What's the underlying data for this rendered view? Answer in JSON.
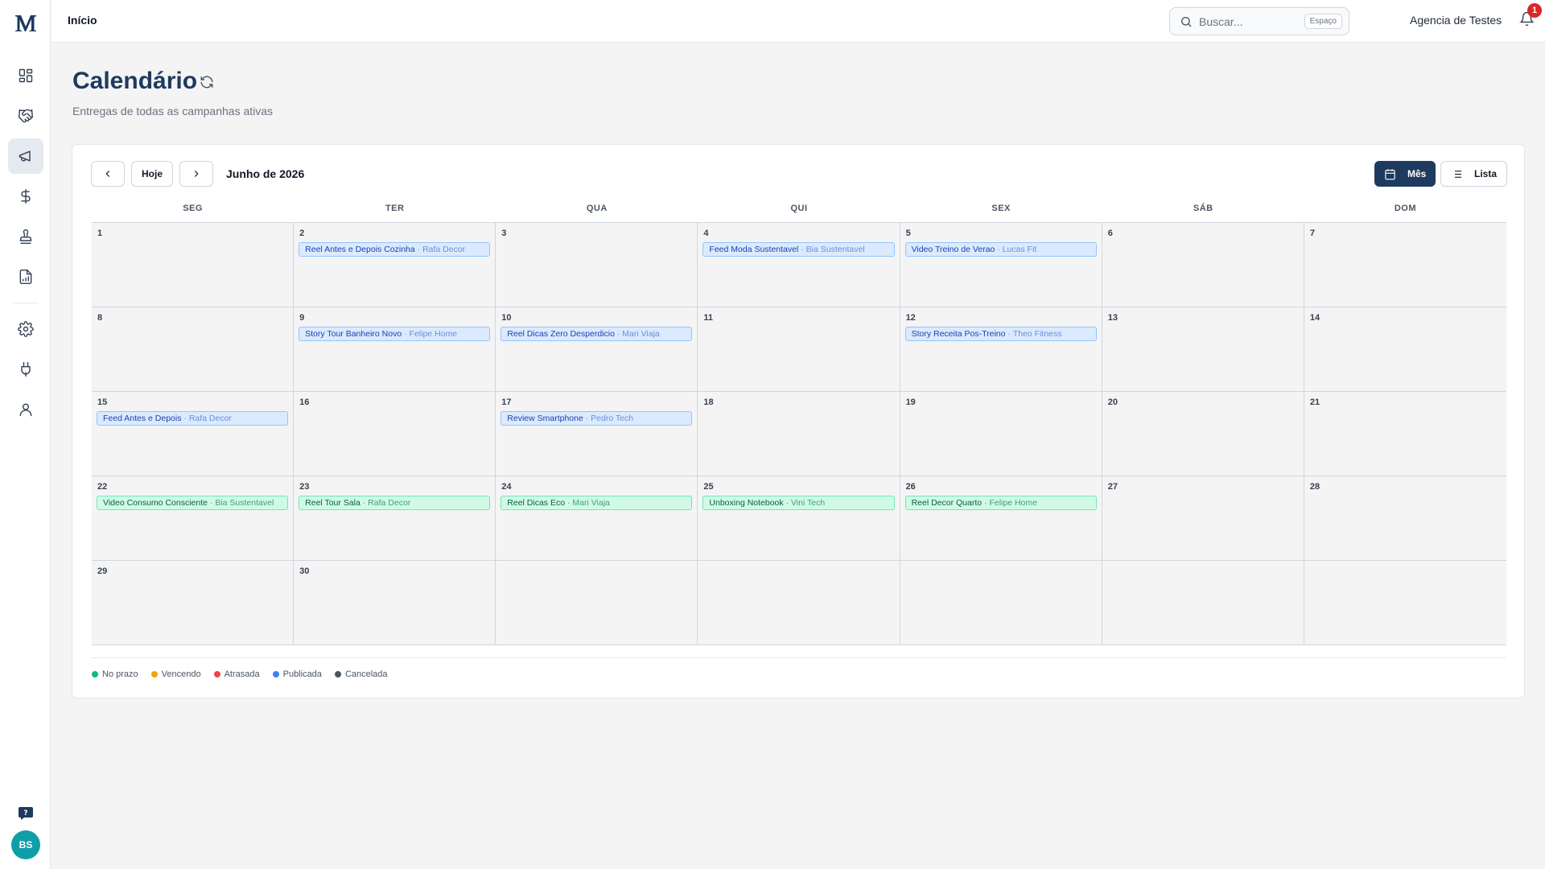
{
  "topbar": {
    "page_name": "Início",
    "search_placeholder": "Buscar...",
    "search_shortcut": "Espaço",
    "agency": "Agencia de Testes",
    "notifications_count": "1"
  },
  "sidebar": {
    "avatar_initials": "BS",
    "items": [
      {
        "name": "dashboard-icon"
      },
      {
        "name": "handshake-icon"
      },
      {
        "name": "megaphone-icon",
        "active": true
      },
      {
        "name": "dollar-icon"
      },
      {
        "name": "stamp-icon"
      },
      {
        "name": "report-icon"
      },
      {
        "name": "gear-icon"
      },
      {
        "name": "plug-icon"
      },
      {
        "name": "user-icon"
      }
    ]
  },
  "page": {
    "title": "Calendário",
    "subtitle": "Entregas de todas as campanhas ativas"
  },
  "calendar": {
    "today_label": "Hoje",
    "month_label": "Junho de 2026",
    "view_month": "Mês",
    "view_list": "Lista",
    "weekdays": [
      "SEG",
      "TER",
      "QUA",
      "QUI",
      "SEX",
      "SÁB",
      "DOM"
    ],
    "days": [
      {
        "n": "1",
        "events": []
      },
      {
        "n": "2",
        "events": [
          {
            "title": "Reel Antes e Depois Cozinha",
            "who": "Rafa Decor",
            "status": "pub"
          }
        ]
      },
      {
        "n": "3",
        "events": []
      },
      {
        "n": "4",
        "events": [
          {
            "title": "Feed Moda Sustentavel",
            "who": "Bia Sustentavel",
            "status": "pub"
          }
        ]
      },
      {
        "n": "5",
        "events": [
          {
            "title": "Video Treino de Verao",
            "who": "Lucas Fit",
            "status": "pub"
          }
        ]
      },
      {
        "n": "6",
        "events": []
      },
      {
        "n": "7",
        "events": []
      },
      {
        "n": "8",
        "events": []
      },
      {
        "n": "9",
        "events": [
          {
            "title": "Story Tour Banheiro Novo",
            "who": "Felipe Home",
            "status": "pub"
          }
        ]
      },
      {
        "n": "10",
        "events": [
          {
            "title": "Reel Dicas Zero Desperdicio",
            "who": "Mari Viaja",
            "status": "pub"
          }
        ]
      },
      {
        "n": "11",
        "events": []
      },
      {
        "n": "12",
        "events": [
          {
            "title": "Story Receita Pos-Treino",
            "who": "Theo Fitness",
            "status": "pub"
          }
        ]
      },
      {
        "n": "13",
        "events": []
      },
      {
        "n": "14",
        "events": []
      },
      {
        "n": "15",
        "events": [
          {
            "title": "Feed Antes e Depois",
            "who": "Rafa Decor",
            "status": "pub"
          }
        ]
      },
      {
        "n": "16",
        "events": []
      },
      {
        "n": "17",
        "events": [
          {
            "title": "Review Smartphone",
            "who": "Pedro Tech",
            "status": "pub"
          }
        ]
      },
      {
        "n": "18",
        "events": []
      },
      {
        "n": "19",
        "events": []
      },
      {
        "n": "20",
        "events": []
      },
      {
        "n": "21",
        "events": []
      },
      {
        "n": "22",
        "events": [
          {
            "title": "Video Consumo Consciente",
            "who": "Bia Sustentavel",
            "status": "ok"
          }
        ]
      },
      {
        "n": "23",
        "events": [
          {
            "title": "Reel Tour Sala",
            "who": "Rafa Decor",
            "status": "ok"
          }
        ]
      },
      {
        "n": "24",
        "events": [
          {
            "title": "Reel Dicas Eco",
            "who": "Mari Viaja",
            "status": "ok"
          }
        ]
      },
      {
        "n": "25",
        "events": [
          {
            "title": "Unboxing Notebook",
            "who": "Vini Tech",
            "status": "ok"
          }
        ]
      },
      {
        "n": "26",
        "events": [
          {
            "title": "Reel Decor Quarto",
            "who": "Felipe Home",
            "status": "ok"
          }
        ]
      },
      {
        "n": "27",
        "events": []
      },
      {
        "n": "28",
        "events": []
      },
      {
        "n": "29",
        "events": []
      },
      {
        "n": "30",
        "events": []
      },
      {
        "n": "",
        "events": []
      },
      {
        "n": "",
        "events": []
      },
      {
        "n": "",
        "events": []
      },
      {
        "n": "",
        "events": []
      },
      {
        "n": "",
        "events": []
      }
    ]
  },
  "legend": [
    {
      "label": "No prazo",
      "color": "#10b981"
    },
    {
      "label": "Vencendo",
      "color": "#f59e0b"
    },
    {
      "label": "Atrasada",
      "color": "#ef4444"
    },
    {
      "label": "Publicada",
      "color": "#3b82f6"
    },
    {
      "label": "Cancelada",
      "color": "#4b5563"
    }
  ]
}
